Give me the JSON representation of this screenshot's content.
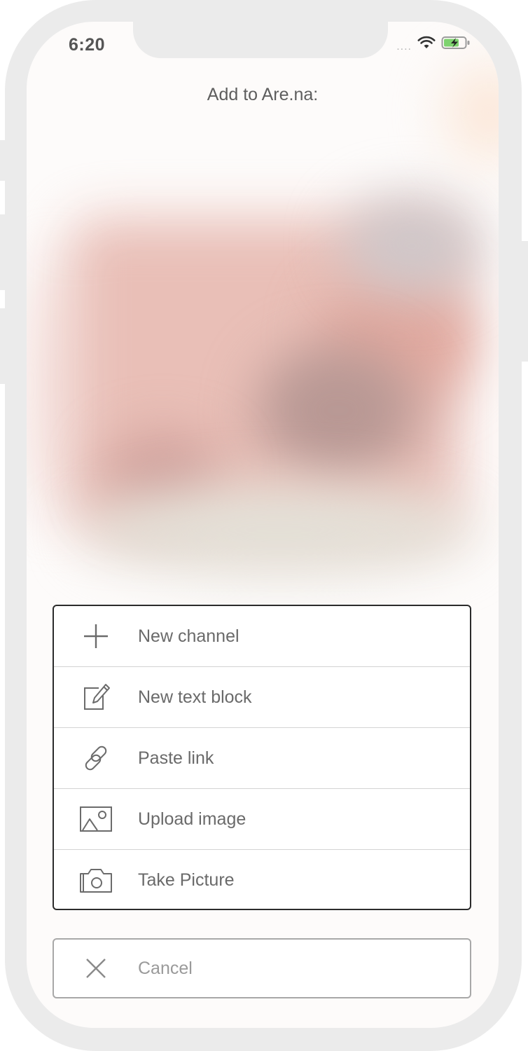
{
  "status_bar": {
    "time": "6:20",
    "signal": "....",
    "wifi_icon": "wifi-icon",
    "battery_icon": "battery-charging-icon"
  },
  "header": {
    "title": "Add to Are.na:"
  },
  "menu": {
    "items": [
      {
        "label": "New channel",
        "icon": "plus-icon"
      },
      {
        "label": "New text block",
        "icon": "edit-icon"
      },
      {
        "label": "Paste link",
        "icon": "link-icon"
      },
      {
        "label": "Upload image",
        "icon": "image-icon"
      },
      {
        "label": "Take Picture",
        "icon": "camera-icon"
      }
    ]
  },
  "cancel": {
    "label": "Cancel",
    "icon": "close-icon"
  },
  "colors": {
    "text": "#6a6a6a",
    "menu_border": "#2b2b2b",
    "cancel_border": "#a8a8a8",
    "frame": "#ebebeb"
  }
}
